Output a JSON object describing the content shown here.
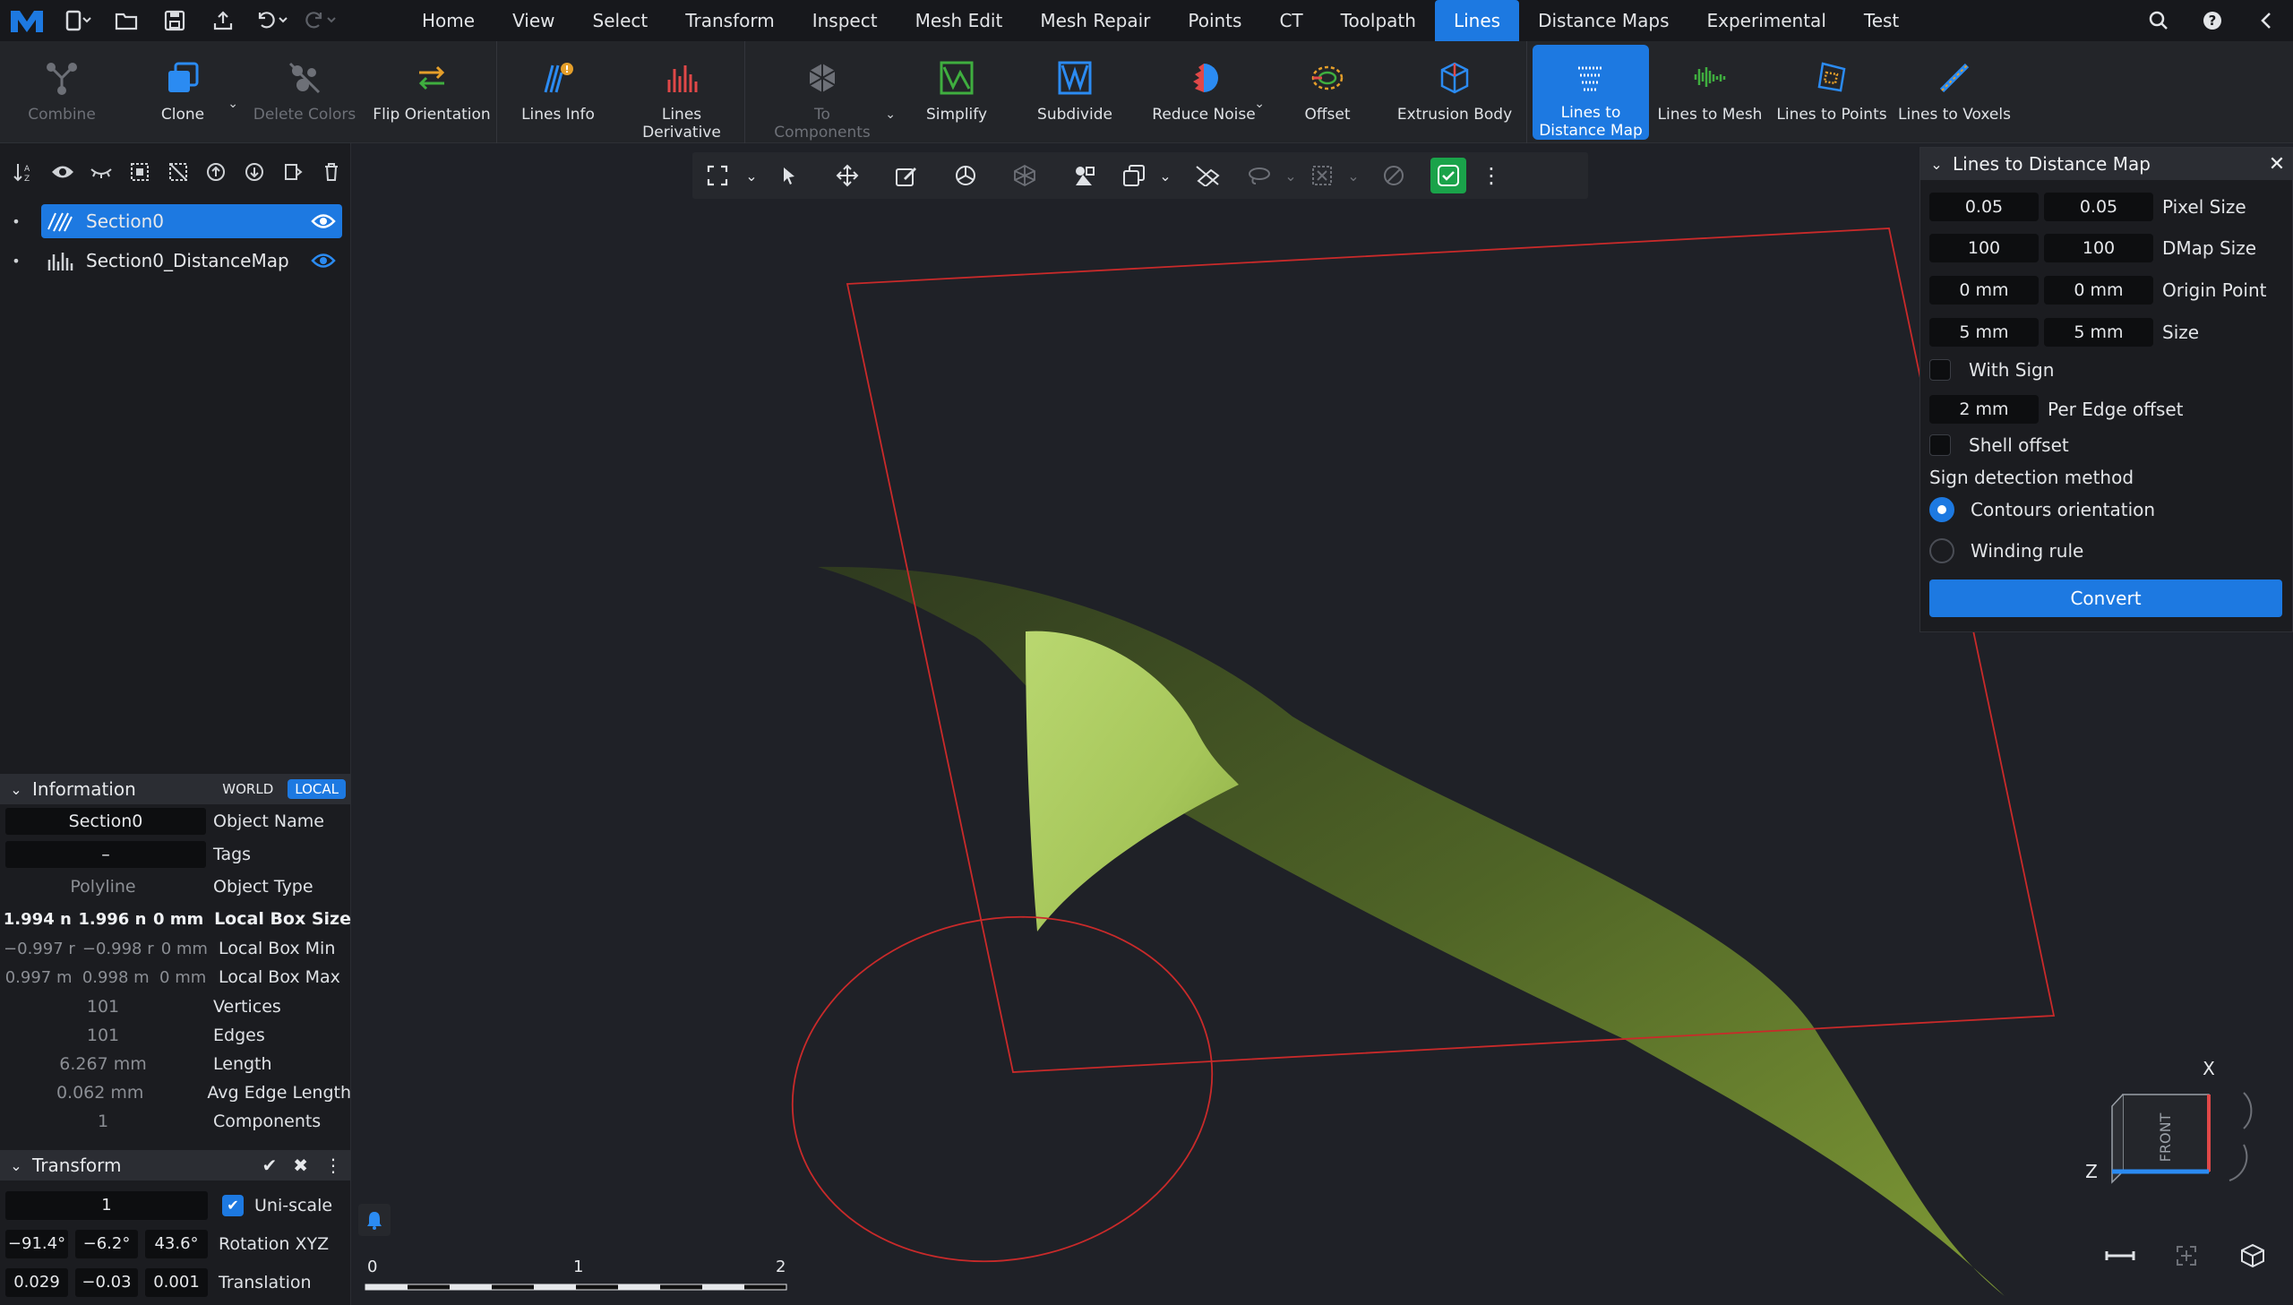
{
  "menu": {
    "tabs": [
      "Home",
      "View",
      "Select",
      "Transform",
      "Inspect",
      "Mesh Edit",
      "Mesh Repair",
      "Points",
      "CT",
      "Toolpath",
      "Lines",
      "Distance Maps",
      "Experimental",
      "Test"
    ],
    "active_tab": "Lines"
  },
  "ribbon": {
    "combine": "Combine",
    "clone": "Clone",
    "delete_colors": "Delete Colors",
    "flip_orientation": "Flip Orientation",
    "lines_info": "Lines Info",
    "lines_derivative_1": "Lines",
    "lines_derivative_2": "Derivative",
    "to_components_1": "To",
    "to_components_2": "Components",
    "simplify": "Simplify",
    "subdivide": "Subdivide",
    "reduce_noise": "Reduce Noise",
    "offset": "Offset",
    "extrusion_body": "Extrusion Body",
    "lines_to_distance_map_1": "Lines to",
    "lines_to_distance_map_2": "Distance Map",
    "lines_to_mesh": "Lines to Mesh",
    "lines_to_points": "Lines to Points",
    "lines_to_voxels": "Lines to Voxels"
  },
  "scene": {
    "items": [
      {
        "name": "Section0",
        "selected": true
      },
      {
        "name": "Section0_DistanceMap",
        "selected": false
      }
    ]
  },
  "information": {
    "title": "Information",
    "world": "WORLD",
    "local": "LOCAL",
    "object_name": "Section0",
    "object_name_label": "Object Name",
    "tags": "–",
    "tags_label": "Tags",
    "object_type": "Polyline",
    "object_type_label": "Object Type",
    "box_size": [
      "1.994 n",
      "1.996 n",
      "0 mm"
    ],
    "box_size_label": "Local Box Size",
    "box_min": [
      "−0.997 r",
      "−0.998 r",
      "0 mm"
    ],
    "box_min_label": "Local Box Min",
    "box_max": [
      "0.997 m",
      "0.998 m",
      "0 mm"
    ],
    "box_max_label": "Local Box Max",
    "vertices": "101",
    "vertices_label": "Vertices",
    "edges": "101",
    "edges_label": "Edges",
    "length": "6.267 mm",
    "length_label": "Length",
    "avg_edge": "0.062 mm",
    "avg_edge_label": "Avg Edge Length",
    "components": "1",
    "components_label": "Components"
  },
  "transform": {
    "title": "Transform",
    "scale": "1",
    "uniscale_label": "Uni-scale",
    "rotation": [
      "−91.4°",
      "−6.2°",
      "43.6°"
    ],
    "rotation_label": "Rotation XYZ",
    "translation": [
      "0.029 m",
      "−0.03 m",
      "0.001 m"
    ],
    "translation_label": "Translation"
  },
  "panel": {
    "title": "Lines to Distance Map",
    "pixel_size": [
      "0.05",
      "0.05"
    ],
    "pixel_size_label": "Pixel Size",
    "dmap_size": [
      "100",
      "100"
    ],
    "dmap_size_label": "DMap Size",
    "origin_point": [
      "0 mm",
      "0 mm"
    ],
    "origin_point_label": "Origin Point",
    "size": [
      "5 mm",
      "5 mm"
    ],
    "size_label": "Size",
    "with_sign_label": "With Sign",
    "per_edge_offset": "2 mm",
    "per_edge_offset_label": "Per Edge offset",
    "shell_offset_label": "Shell offset",
    "sign_method_label": "Sign detection method",
    "contours_orientation_label": "Contours orientation",
    "winding_rule_label": "Winding rule",
    "convert_label": "Convert"
  },
  "scale_bar": {
    "ticks": [
      "0",
      "1",
      "2"
    ]
  },
  "view_cube": {
    "x_label": "X",
    "z_label": "Z",
    "face_label": "FRONT"
  },
  "colors": {
    "accent": "#1d79e1",
    "surface": "#8fae3c",
    "outline": "#c92a2a"
  }
}
